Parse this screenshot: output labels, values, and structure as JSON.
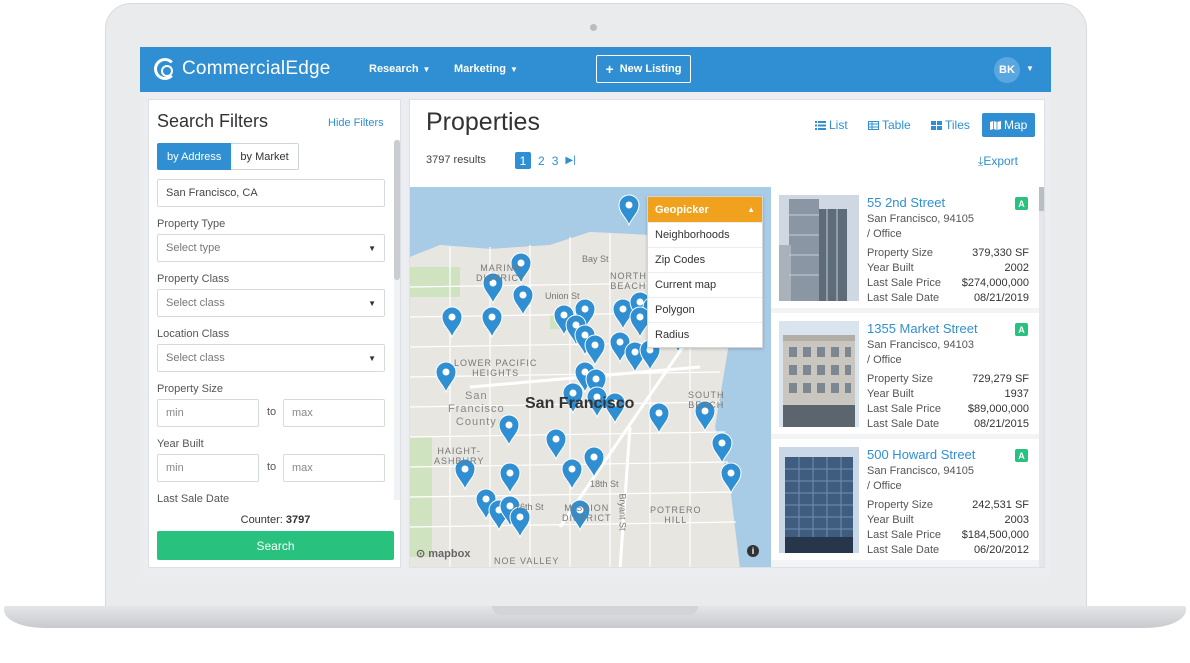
{
  "header": {
    "brand": "CommercialEdge",
    "nav": [
      {
        "label": "Research"
      },
      {
        "label": "Marketing"
      }
    ],
    "new_listing": "New Listing",
    "avatar": "BK",
    "accent": "#2f8fd2"
  },
  "filters": {
    "title": "Search Filters",
    "hide_label": "Hide Filters",
    "tabs": [
      "by Address",
      "by Market"
    ],
    "address_value": "San Francisco, CA",
    "property_type_label": "Property Type",
    "property_type_placeholder": "Select type",
    "property_class_label": "Property Class",
    "property_class_placeholder": "Select class",
    "location_class_label": "Location Class",
    "location_class_placeholder": "Select class",
    "property_size_label": "Property Size",
    "year_built_label": "Year Built",
    "min_placeholder": "min",
    "max_placeholder": "max",
    "to_label": "to",
    "last_sale_date_label": "Last Sale Date",
    "counter_label": "Counter:",
    "counter_value": "3797",
    "search_label": "Search"
  },
  "properties": {
    "title": "Properties",
    "views": [
      "List",
      "Table",
      "Tiles",
      "Map"
    ],
    "active_view": "Map",
    "results": "3797 results",
    "pages": [
      "1",
      "2",
      "3"
    ],
    "current_page": "1",
    "export_label": "Export"
  },
  "map": {
    "geopicker": {
      "title": "Geopicker",
      "items": [
        "Neighborhoods",
        "Zip Codes",
        "Current map",
        "Polygon",
        "Radius"
      ]
    },
    "labels": {
      "city": "San Francisco",
      "marina": "MARINA\nDISTRICT",
      "bay_st": "Bay St",
      "north_beach": "NORTH\nBEACH",
      "union_st": "Union St",
      "lower_pacific": "LOWER PACIFIC\nHEIGHTS",
      "sf_county": "San\nFrancisco\nCounty",
      "south_beach": "SOUTH\nBEACH",
      "haight": "HAIGHT-\nASHBURY",
      "st_16": "16th St",
      "st_18": "18th St",
      "mission": "MISSION\nDISTRICT",
      "bryant": "Bryant St",
      "potrero": "POTRERO\nHILL",
      "noe": "NOE VALLEY"
    },
    "attribution": "mapbox",
    "info": "i",
    "pin_color": "#2f8fd2"
  },
  "listings": [
    {
      "title": "55 2nd Street",
      "badge": "A",
      "city": "San Francisco, 94105",
      "type": "/ Office",
      "size_label": "Property Size",
      "size": "379,330 SF",
      "year_label": "Year Built",
      "year": "2002",
      "price_label": "Last Sale Price",
      "price": "$274,000,000",
      "date_label": "Last Sale Date",
      "date": "08/21/2019"
    },
    {
      "title": "1355 Market Street",
      "badge": "A",
      "city": "San Francisco, 94103",
      "type": "/ Office",
      "size_label": "Property Size",
      "size": "729,279 SF",
      "year_label": "Year Built",
      "year": "1937",
      "price_label": "Last Sale Price",
      "price": "$89,000,000",
      "date_label": "Last Sale Date",
      "date": "08/21/2015"
    },
    {
      "title": "500 Howard Street",
      "badge": "A",
      "city": "San Francisco, 94105",
      "type": "/ Office",
      "size_label": "Property Size",
      "size": "242,531 SF",
      "year_label": "Year Built",
      "year": "2003",
      "price_label": "Last Sale Price",
      "price": "$184,500,000",
      "date_label": "Last Sale Date",
      "date": "06/20/2012"
    }
  ]
}
